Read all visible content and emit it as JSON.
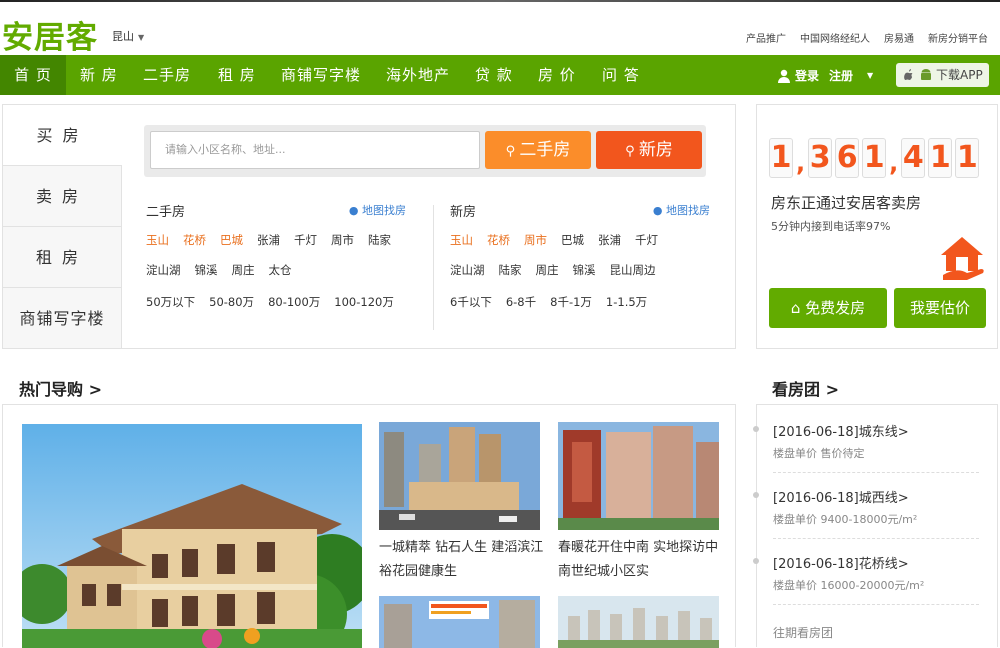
{
  "header": {
    "logo": "安居客",
    "city": "昆山",
    "top_links": [
      "产品推广",
      "中国网络经纪人",
      "房易通",
      "新房分销平台"
    ]
  },
  "nav": {
    "items": [
      "首 页",
      "新 房",
      "二手房",
      "租 房",
      "商铺写字楼",
      "海外地产",
      "贷 款",
      "房 价",
      "问 答"
    ],
    "login": "登录",
    "register": "注册",
    "app": "下载APP"
  },
  "search": {
    "tabs": [
      "买房",
      "卖房",
      "租房",
      "商铺写字楼"
    ],
    "placeholder": "请输入小区名称、地址...",
    "btn_second": "二手房",
    "btn_new": "新房",
    "second": {
      "title": "二手房",
      "map": "地图找房",
      "areas1": [
        "玉山",
        "花桥",
        "巴城",
        "张浦",
        "千灯",
        "周市",
        "陆家"
      ],
      "areas2": [
        "淀山湖",
        "锦溪",
        "周庄",
        "太仓"
      ],
      "prices": [
        "50万以下",
        "50-80万",
        "80-100万",
        "100-120万"
      ]
    },
    "newhouse": {
      "title": "新房",
      "map": "地图找房",
      "areas1": [
        "玉山",
        "花桥",
        "周市",
        "巴城",
        "张浦",
        "千灯"
      ],
      "areas2": [
        "淀山湖",
        "陆家",
        "周庄",
        "锦溪",
        "昆山周边"
      ],
      "prices": [
        "6千以下",
        "6-8千",
        "8千-1万",
        "1-1.5万"
      ]
    }
  },
  "seller": {
    "digits": [
      "1",
      "3",
      "6",
      "1",
      "4",
      "1",
      "1"
    ],
    "headline": "房东正通过安居客卖房",
    "rate": "5分钟内接到电话率97%",
    "btn_publish": "免费发房",
    "btn_estimate": "我要估价"
  },
  "hot": {
    "title": "热门导购 >",
    "captions": [
      "一城精萃 钻石人生 建滔滨江裕花园健康生",
      "春暖花开住中南 实地探访中南世纪城小区实"
    ]
  },
  "tour": {
    "title": "看房团 >",
    "items": [
      {
        "title": "[2016-06-18]城东线>",
        "price": "楼盘单价 售价待定"
      },
      {
        "title": "[2016-06-18]城西线>",
        "price": "楼盘单价 9400-18000元/m²"
      },
      {
        "title": "[2016-06-18]花桥线>",
        "price": "楼盘单价 16000-20000元/m²"
      }
    ],
    "past": "往期看房团"
  },
  "colors": {
    "green": "#5aa400",
    "orange": "#fb8d2a",
    "red": "#f2561d"
  }
}
